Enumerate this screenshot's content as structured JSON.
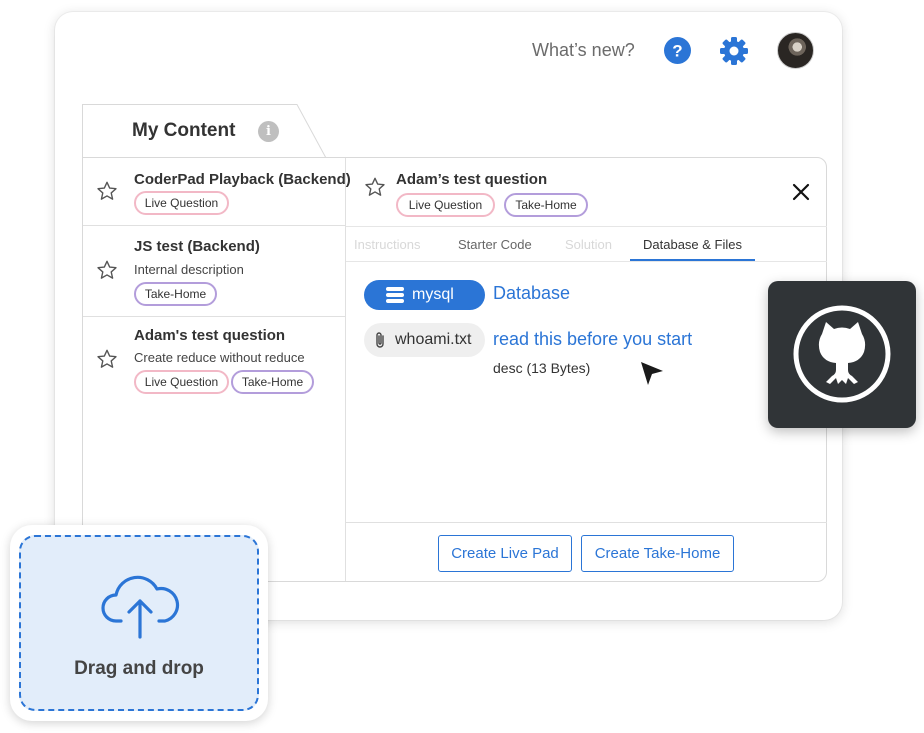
{
  "header": {
    "whats_new": "What’s new?",
    "icons": [
      "help-icon",
      "gear-icon",
      "avatar"
    ]
  },
  "content_tab": {
    "title": "My Content",
    "info_icon": "i"
  },
  "questions": [
    {
      "title": "CoderPad Playback (Backend)",
      "description": "",
      "tags": [
        "Live Question"
      ]
    },
    {
      "title": "JS test (Backend)",
      "description": "Internal description",
      "tags": [
        "Take-Home"
      ]
    },
    {
      "title": "Adam's test question",
      "description": "Create reduce without reduce",
      "tags": [
        "Live Question",
        "Take-Home"
      ]
    }
  ],
  "detail": {
    "title": "Adam’s test question",
    "tags": [
      "Live Question",
      "Take-Home"
    ],
    "tabs": [
      "Instructions",
      "Starter Code",
      "Solution",
      "Database & Files"
    ],
    "active_tab": "Database & Files",
    "database": {
      "chip": "mysql",
      "link": "Database"
    },
    "file": {
      "chip": "whoami.txt",
      "link": "read this before you start",
      "desc": "desc (13 Bytes)"
    },
    "buttons": {
      "live": "Create Live Pad",
      "take_home": "Create Take-Home"
    }
  },
  "dropzone": {
    "label": "Drag and drop"
  },
  "colors": {
    "accent": "#2b75d6",
    "live_tag": "#f2b8c6",
    "take_home_tag": "#b39ddb",
    "github_bg": "#303437",
    "dropzone_bg": "#e2edfa"
  }
}
